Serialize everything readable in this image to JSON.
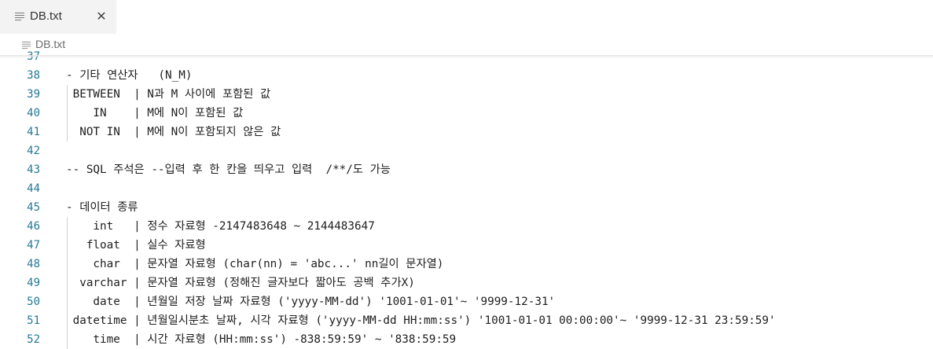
{
  "tab": {
    "label": "DB.txt",
    "close_glyph": "✕"
  },
  "breadcrumb": {
    "label": "DB.txt"
  },
  "icons": {
    "file": "file-text-icon",
    "close": "close-icon"
  },
  "colors": {
    "line_number": "#237893",
    "text": "#1e1e1e",
    "tab_bg": "#f3f3f3"
  },
  "lines": [
    {
      "num": "37",
      "text": ""
    },
    {
      "num": "38",
      "text": "- 기타 연산자   (N_M)"
    },
    {
      "num": "39",
      "text": " BETWEEN  | N과 M 사이에 포함된 값"
    },
    {
      "num": "40",
      "text": "    IN    | M에 N이 포함된 값"
    },
    {
      "num": "41",
      "text": "  NOT IN  | M에 N이 포함되지 않은 값"
    },
    {
      "num": "42",
      "text": ""
    },
    {
      "num": "43",
      "text": "-- SQL 주석은 --입력 후 한 칸을 띄우고 입력  /**/도 가능"
    },
    {
      "num": "44",
      "text": ""
    },
    {
      "num": "45",
      "text": "- 데이터 종류"
    },
    {
      "num": "46",
      "text": "    int   | 정수 자료형 -2147483648 ~ 2144483647"
    },
    {
      "num": "47",
      "text": "   float  | 실수 자료형"
    },
    {
      "num": "48",
      "text": "    char  | 문자열 자료형 (char(nn) = 'abc...' nn길이 문자열)"
    },
    {
      "num": "49",
      "text": "  varchar | 문자열 자료형 (정해진 글자보다 짧아도 공백 추가X)"
    },
    {
      "num": "50",
      "text": "    date  | 년월일 저장 날짜 자료형 ('yyyy-MM-dd') '1001-01-01'~ '9999-12-31'"
    },
    {
      "num": "51",
      "text": " datetime | 년월일시분초 날짜, 시각 자료형 ('yyyy-MM-dd HH:mm:ss') '1001-01-01 00:00:00'~ '9999-12-31 23:59:59'"
    },
    {
      "num": "52",
      "text": "    time  | 시간 자료형 (HH:mm:ss') -838:59:59' ~ '838:59:59"
    }
  ]
}
